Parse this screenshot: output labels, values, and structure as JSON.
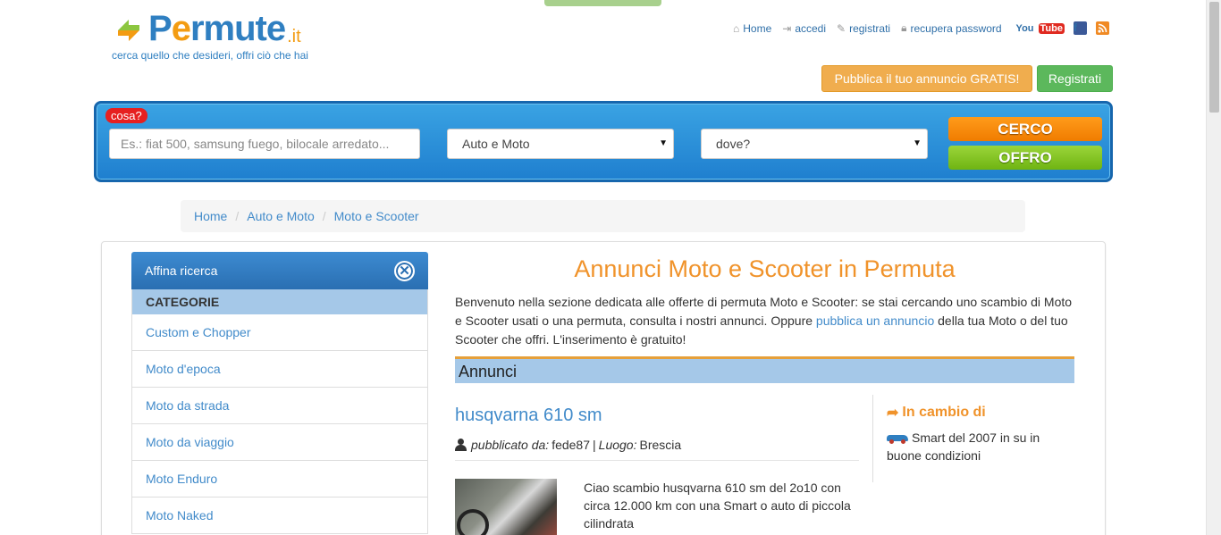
{
  "header": {
    "logo_text_pre": "P",
    "logo_text_e": "e",
    "logo_text_post": "rmute",
    "logo_tld": ".it",
    "tagline": "cerca quello che desideri, offri ciò che hai",
    "links": {
      "home": "Home",
      "accedi": "accedi",
      "registrati": "registrati",
      "recupera": "recupera password"
    },
    "social": {
      "youtube_you": "You",
      "youtube_tube": "Tube",
      "facebook": "f"
    },
    "publish_button": "Pubblica il tuo annuncio GRATIS!",
    "register_button": "Registrati"
  },
  "search": {
    "badge": "cosa?",
    "placeholder": "Es.: fiat 500, samsung fuego, bilocale arredato...",
    "category": "Auto e Moto",
    "location": "dove?",
    "cerco": "CERCO",
    "offro": "OFFRO"
  },
  "breadcrumb": [
    "Home",
    "Auto e Moto",
    "Moto e Scooter"
  ],
  "sidebar": {
    "title": "Affina ricerca",
    "section": "CATEGORIE",
    "items": [
      "Custom e Chopper",
      "Moto d'epoca",
      "Moto da strada",
      "Moto da viaggio",
      "Moto Enduro",
      "Moto Naked"
    ]
  },
  "main": {
    "title": "Annunci Moto e Scooter in Permuta",
    "intro_1": "Benvenuto nella sezione dedicata alle offerte di permuta Moto e Scooter: se stai cercando uno scambio di Moto e Scooter usati o una permuta, consulta i nostri annunci. Oppure ",
    "intro_link": "pubblica un annuncio",
    "intro_2": " della tua Moto o del tuo Scooter che offri. L'inserimento è gratuito!",
    "annunci_header": "Annunci"
  },
  "listing": {
    "title": "husqvarna 610 sm",
    "published_label": "pubblicato da:",
    "user": "fede87",
    "sep": "|",
    "place_label": "Luogo:",
    "place": "Brescia",
    "description": "Ciao scambio husqvarna 610 sm del 2o10 con circa 12.000 km con una Smart o auto di piccola cilindrata",
    "cambio_label": "In cambio di",
    "cambio_text": "Smart del 2007 in su in buone condizioni"
  },
  "colors": {
    "brand_blue": "#2f7fc1",
    "orange": "#f0932b",
    "green": "#5cb85c",
    "link": "#428bca"
  }
}
